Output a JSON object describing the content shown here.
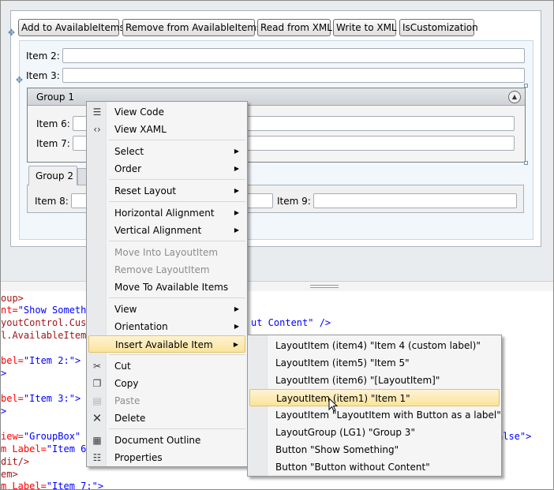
{
  "toolbar": {
    "add_available": "Add to AvailableItems",
    "remove_available": "Remove from AvailableItems",
    "read_xml": "Read from XML",
    "write_xml": "Write to XML",
    "is_customization": "IsCustomization"
  },
  "layout": {
    "item2_label": "Item 2:",
    "item3_label": "Item 3:",
    "group1_title": "Group 1",
    "item6_label": "Item 6:",
    "item7_label": "Item 7:",
    "group2_tab": "Group 2",
    "item8_label": "Item 8:",
    "item9_label": "Item 9:"
  },
  "xaml": {
    "l1": "oup>",
    "l2a": "nt=",
    "l2b": "\"Show Someth",
    "l2c": "ut Content\"",
    "l2d": " />",
    "l3": "youtControl.Cust",
    "l4": "l.AvailableItem",
    "l5a": "bel=",
    "l5b": "\"Item 2:\"",
    "l5c": ">",
    "l6": ">",
    "l7a": "bel=",
    "l7b": "\"Item 3:\"",
    "l7c": ">",
    "l8": ">",
    "l9a": "iew=",
    "l9b": "\"GroupBox\"",
    "l9c": "alse\"",
    "l9d": ">",
    "l10a": "m Label=",
    "l10b": "\"Item 6",
    "l11": "dit/>",
    "l12": "em>",
    "l13a": "m Label=",
    "l13b": "\"Item 7:\"",
    "l13c": ">"
  },
  "context_menu": {
    "view_code": "View Code",
    "view_xaml": "View XAML",
    "select": "Select",
    "order": "Order",
    "reset_layout": "Reset Layout",
    "horizontal_alignment": "Horizontal Alignment",
    "vertical_alignment": "Vertical Alignment",
    "move_into_layoutitem": "Move Into LayoutItem",
    "remove_layoutitem": "Remove LayoutItem",
    "move_to_available": "Move To Available Items",
    "view": "View",
    "orientation": "Orientation",
    "insert_available": "Insert Available Item",
    "cut": "Cut",
    "copy": "Copy",
    "paste": "Paste",
    "delete": "Delete",
    "document_outline": "Document Outline",
    "properties": "Properties"
  },
  "submenu": {
    "items": [
      "LayoutItem (item4) \"Item 4 (custom label)\"",
      "LayoutItem (item5) \"Item 5\"",
      "LayoutItem (item6) \"[LayoutItem]\"",
      "LayoutItem (item1) \"Item 1\"",
      "LayoutItem \"LayoutItem with Button as a label\"",
      "LayoutGroup (LG1) \"Group 3\"",
      "Button \"Show Something\"",
      "Button \"Button without Content\""
    ],
    "highlighted_index": 3
  },
  "icons": {
    "view_code": "code-file-icon",
    "view_xaml": "xaml-file-icon",
    "cut": "scissors-icon",
    "copy": "copy-icon",
    "paste": "paste-icon",
    "delete": "delete-x-icon",
    "document_outline": "document-outline-icon",
    "properties": "properties-icon"
  },
  "colors": {
    "highlight": "#fbe49a",
    "xaml_tag": "#a31515",
    "xaml_attr": "#ff0000",
    "xaml_value": "#0000ff"
  }
}
